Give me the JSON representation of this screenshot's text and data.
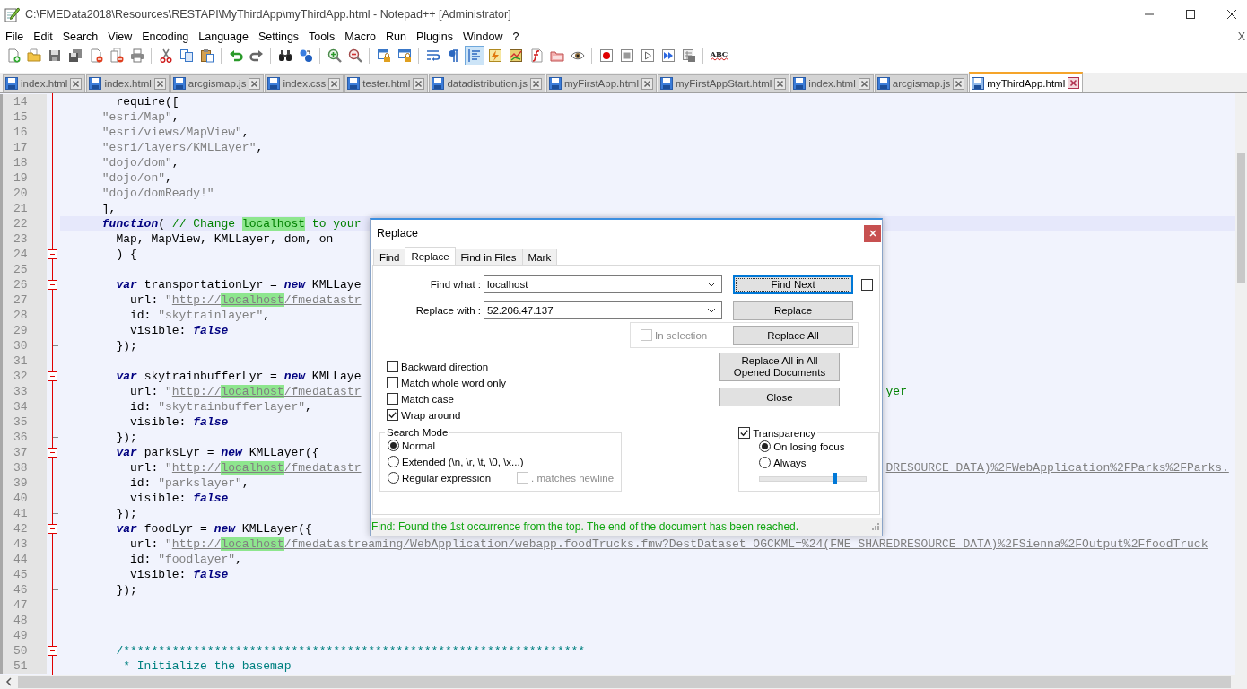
{
  "window": {
    "title": "C:\\FMEData2018\\Resources\\RESTAPI\\MyThirdApp\\myThirdApp.html - Notepad++ [Administrator]"
  },
  "menu": [
    "File",
    "Edit",
    "Search",
    "View",
    "Encoding",
    "Language",
    "Settings",
    "Tools",
    "Macro",
    "Run",
    "Plugins",
    "Window",
    "?"
  ],
  "menu_close": "X",
  "toolbar": [
    {
      "kind": "new",
      "pressed": false
    },
    {
      "kind": "open",
      "pressed": false
    },
    {
      "kind": "save",
      "pressed": false
    },
    {
      "kind": "save-all",
      "pressed": false
    },
    {
      "kind": "close",
      "pressed": false
    },
    {
      "kind": "close-all",
      "pressed": false
    },
    {
      "kind": "print",
      "pressed": false
    },
    {
      "kind": "separator"
    },
    {
      "kind": "cut",
      "pressed": false
    },
    {
      "kind": "copy",
      "pressed": false
    },
    {
      "kind": "paste",
      "pressed": false
    },
    {
      "kind": "separator"
    },
    {
      "kind": "undo",
      "pressed": false
    },
    {
      "kind": "redo",
      "pressed": false
    },
    {
      "kind": "separator"
    },
    {
      "kind": "find",
      "pressed": false
    },
    {
      "kind": "replace",
      "pressed": false
    },
    {
      "kind": "separator"
    },
    {
      "kind": "zoom-in",
      "pressed": false
    },
    {
      "kind": "zoom-out",
      "pressed": false
    },
    {
      "kind": "separator"
    },
    {
      "kind": "sync-vertical",
      "pressed": false
    },
    {
      "kind": "sync-horizontal",
      "pressed": false
    },
    {
      "kind": "separator"
    },
    {
      "kind": "wrap",
      "pressed": false
    },
    {
      "kind": "all-chars",
      "pressed": false
    },
    {
      "kind": "indent-guide",
      "pressed": true
    },
    {
      "kind": "language",
      "pressed": false
    },
    {
      "kind": "doc-map",
      "pressed": false
    },
    {
      "kind": "function-list",
      "pressed": false
    },
    {
      "kind": "folder",
      "pressed": false
    },
    {
      "kind": "monitor",
      "pressed": false
    },
    {
      "kind": "separator"
    },
    {
      "kind": "record",
      "pressed": false
    },
    {
      "kind": "stop",
      "pressed": false
    },
    {
      "kind": "play",
      "pressed": false
    },
    {
      "kind": "play-multiple",
      "pressed": false
    },
    {
      "kind": "save-macro",
      "pressed": false
    },
    {
      "kind": "separator"
    },
    {
      "kind": "spellcheck",
      "label": "ABC"
    }
  ],
  "tabs": [
    {
      "label": "index.html",
      "selected": false
    },
    {
      "label": "index.html",
      "selected": false
    },
    {
      "label": "arcgismap.js",
      "selected": false
    },
    {
      "label": "index.css",
      "selected": false
    },
    {
      "label": "tester.html",
      "selected": false
    },
    {
      "label": "datadistribution.js",
      "selected": false
    },
    {
      "label": "myFirstApp.html",
      "selected": false
    },
    {
      "label": "myFirstAppStart.html",
      "selected": false
    },
    {
      "label": "index.html",
      "selected": false
    },
    {
      "label": "arcgismap.js",
      "selected": false
    },
    {
      "label": "myThirdApp.html",
      "selected": true
    }
  ],
  "editor": {
    "lines": [
      {
        "number": "14",
        "code": [
          {
            "text": "        require([",
            "kind": "plain"
          }
        ]
      },
      {
        "number": "15",
        "code": [
          {
            "text": "      \"esri/Map\"",
            "kind": "string"
          },
          {
            "text": ",",
            "kind": "plain"
          }
        ]
      },
      {
        "number": "16",
        "code": [
          {
            "text": "      \"esri/views/MapView\"",
            "kind": "string"
          },
          {
            "text": ",",
            "kind": "plain"
          }
        ]
      },
      {
        "number": "17",
        "code": [
          {
            "text": "      \"esri/layers/KMLLayer\"",
            "kind": "string"
          },
          {
            "text": ",",
            "kind": "plain"
          }
        ]
      },
      {
        "number": "18",
        "code": [
          {
            "text": "      \"dojo/dom\"",
            "kind": "string"
          },
          {
            "text": ",",
            "kind": "plain"
          }
        ]
      },
      {
        "number": "19",
        "code": [
          {
            "text": "      \"dojo/on\"",
            "kind": "string"
          },
          {
            "text": ",",
            "kind": "plain"
          }
        ]
      },
      {
        "number": "20",
        "code": [
          {
            "text": "      \"dojo/domReady!\"",
            "kind": "string"
          }
        ]
      },
      {
        "number": "21",
        "code": [
          {
            "text": "      ],",
            "kind": "plain"
          }
        ]
      },
      {
        "number": "22",
        "current": true,
        "code": [
          {
            "text": "      function",
            "kind": "keyword"
          },
          {
            "text": "( ",
            "kind": "plain"
          },
          {
            "text": "// Change ",
            "kind": "comment"
          },
          {
            "text": "localhost",
            "kind": "comment-hit"
          },
          {
            "text": " to your",
            "kind": "comment"
          }
        ]
      },
      {
        "number": "23",
        "code": [
          {
            "text": "        Map, MapView, KMLLayer, dom, on",
            "kind": "plain"
          }
        ]
      },
      {
        "number": "24",
        "kind": "fold-start",
        "code": [
          {
            "text": "        ) {",
            "kind": "plain"
          }
        ]
      },
      {
        "number": "25"
      },
      {
        "number": "26",
        "kind": "fold-start",
        "code": [
          {
            "text": "        var",
            "kind": "keyword"
          },
          {
            "text": " transportationLyr = ",
            "kind": "plain"
          },
          {
            "text": "new",
            "kind": "keyword"
          },
          {
            "text": " KMLLaye",
            "kind": "plain"
          }
        ]
      },
      {
        "number": "27",
        "code": [
          {
            "text": "          url: ",
            "kind": "plain"
          },
          {
            "text": "\"",
            "kind": "string"
          },
          {
            "text": "http://",
            "kind": "link"
          },
          {
            "text": "localhost",
            "kind": "link-hit"
          },
          {
            "text": "/fmedatastr",
            "kind": "link"
          }
        ]
      },
      {
        "number": "28",
        "code": [
          {
            "text": "          id: ",
            "kind": "plain"
          },
          {
            "text": "\"skytrainlayer\"",
            "kind": "string"
          },
          {
            "text": ",",
            "kind": "plain"
          }
        ]
      },
      {
        "number": "29",
        "code": [
          {
            "text": "          visible: ",
            "kind": "plain"
          },
          {
            "text": "false",
            "kind": "keyword"
          }
        ]
      },
      {
        "number": "30",
        "kind": "fold-end",
        "code": [
          {
            "text": "        });",
            "kind": "plain"
          }
        ]
      },
      {
        "number": "31"
      },
      {
        "number": "32",
        "kind": "fold-start",
        "code": [
          {
            "text": "        var",
            "kind": "keyword"
          },
          {
            "text": " skytrainbufferLyr = ",
            "kind": "plain"
          },
          {
            "text": "new",
            "kind": "keyword"
          },
          {
            "text": " KMLLaye",
            "kind": "plain"
          }
        ]
      },
      {
        "number": "33",
        "code": [
          {
            "text": "          url: ",
            "kind": "plain"
          },
          {
            "text": "\"",
            "kind": "string"
          },
          {
            "text": "http://",
            "kind": "link"
          },
          {
            "text": "localhost",
            "kind": "link-hit"
          },
          {
            "text": "/fmedatastr",
            "kind": "link"
          }
        ],
        "tail": [
          {
            "text": "yer",
            "kind": "comment"
          }
        ]
      },
      {
        "number": "34",
        "code": [
          {
            "text": "          id: ",
            "kind": "plain"
          },
          {
            "text": "\"skytrainbufferlayer\"",
            "kind": "string"
          },
          {
            "text": ",",
            "kind": "plain"
          }
        ]
      },
      {
        "number": "35",
        "code": [
          {
            "text": "          visible: ",
            "kind": "plain"
          },
          {
            "text": "false",
            "kind": "keyword"
          }
        ]
      },
      {
        "number": "36",
        "kind": "fold-end",
        "code": [
          {
            "text": "        });",
            "kind": "plain"
          }
        ]
      },
      {
        "number": "37",
        "kind": "fold-start",
        "code": [
          {
            "text": "        var",
            "kind": "keyword"
          },
          {
            "text": " parksLyr = ",
            "kind": "plain"
          },
          {
            "text": "new",
            "kind": "keyword"
          },
          {
            "text": " KMLLayer({",
            "kind": "plain"
          }
        ]
      },
      {
        "number": "38",
        "code": [
          {
            "text": "          url: ",
            "kind": "plain"
          },
          {
            "text": "\"",
            "kind": "string"
          },
          {
            "text": "http://",
            "kind": "link"
          },
          {
            "text": "localhost",
            "kind": "link-hit"
          },
          {
            "text": "/fmedatastr",
            "kind": "link"
          }
        ],
        "tail": [
          {
            "text": "DRESOURCE_DATA)%2FWebApplication%2FParks%2FParks.",
            "kind": "link"
          }
        ]
      },
      {
        "number": "39",
        "code": [
          {
            "text": "          id: ",
            "kind": "plain"
          },
          {
            "text": "\"parkslayer\"",
            "kind": "string"
          },
          {
            "text": ",",
            "kind": "plain"
          }
        ]
      },
      {
        "number": "40",
        "code": [
          {
            "text": "          visible: ",
            "kind": "plain"
          },
          {
            "text": "false",
            "kind": "keyword"
          }
        ]
      },
      {
        "number": "41",
        "kind": "fold-end",
        "code": [
          {
            "text": "        });",
            "kind": "plain"
          }
        ]
      },
      {
        "number": "42",
        "kind": "fold-start",
        "code": [
          {
            "text": "        var",
            "kind": "keyword"
          },
          {
            "text": " foodLyr = ",
            "kind": "plain"
          },
          {
            "text": "new",
            "kind": "keyword"
          },
          {
            "text": " KMLLayer({",
            "kind": "plain"
          }
        ]
      },
      {
        "number": "43",
        "code": [
          {
            "text": "          url: ",
            "kind": "plain"
          },
          {
            "text": "\"",
            "kind": "string"
          },
          {
            "text": "http://",
            "kind": "link"
          },
          {
            "text": "localhost",
            "kind": "link-hit"
          },
          {
            "text": "/fmedatastreaming/WebApplication/webapp.foodTrucks.fmw?DestDataset_OGCKML=%24(FME_SHAREDRESOURCE_DATA)%2FSienna%2FOutput%2FfoodTruck",
            "kind": "link"
          }
        ]
      },
      {
        "number": "44",
        "code": [
          {
            "text": "          id: ",
            "kind": "plain"
          },
          {
            "text": "\"foodlayer\"",
            "kind": "string"
          },
          {
            "text": ",",
            "kind": "plain"
          }
        ]
      },
      {
        "number": "45",
        "code": [
          {
            "text": "          visible: ",
            "kind": "plain"
          },
          {
            "text": "false",
            "kind": "keyword"
          }
        ]
      },
      {
        "number": "46",
        "kind": "fold-end",
        "code": [
          {
            "text": "        });",
            "kind": "plain"
          }
        ]
      },
      {
        "number": "47"
      },
      {
        "number": "48"
      },
      {
        "number": "49"
      },
      {
        "number": "50",
        "kind": "fold-start",
        "code": [
          {
            "text": "        /******************************************************************",
            "kind": "doc"
          }
        ]
      },
      {
        "number": "51",
        "code": [
          {
            "text": "         * Initialize the basemap",
            "kind": "doc"
          }
        ]
      }
    ]
  },
  "dialog": {
    "title": "Replace",
    "tabs": [
      {
        "label": "Find",
        "selected": false
      },
      {
        "label": "Replace",
        "selected": true
      },
      {
        "label": "Find in Files",
        "selected": false
      },
      {
        "label": "Mark",
        "selected": false
      }
    ],
    "find_what": {
      "label": "Find what :",
      "value": "localhost"
    },
    "replace_with": {
      "label": "Replace with :",
      "value": "52.206.47.137"
    },
    "buttons": [
      {
        "label": "Find Next",
        "focused": true
      },
      {
        "label": "Replace",
        "focused": false
      },
      {
        "label": "Replace All",
        "focused": false
      },
      {
        "label": "Replace All in All Opened Documents",
        "focused": false
      },
      {
        "label": "Close",
        "focused": false
      }
    ],
    "side_checkbox": {
      "checked": false
    },
    "in_selection": {
      "label": "In selection",
      "checked": false,
      "disabled": true
    },
    "options": [
      {
        "label": "Backward direction",
        "checked": false
      },
      {
        "label": "Match whole word only",
        "checked": false
      },
      {
        "label": "Match case",
        "checked": false
      },
      {
        "label": "Wrap around",
        "checked": true
      }
    ],
    "search_mode": {
      "title": "Search Mode",
      "options": [
        {
          "label": "Normal",
          "selected": true
        },
        {
          "label": "Extended (\\n, \\r, \\t, \\0, \\x...)",
          "selected": false
        },
        {
          "label": "Regular expression",
          "selected": false
        }
      ],
      "matches_newline": {
        "label": ". matches newline",
        "checked": false,
        "disabled": true
      }
    },
    "transparency": {
      "label": "Transparency",
      "checked": true,
      "options": [
        {
          "label": "On losing focus",
          "selected": true
        },
        {
          "label": "Always",
          "selected": false
        }
      ],
      "level": 0.71
    },
    "status": "Find: Found the 1st occurrence from the top. The end of the document has been reached."
  }
}
